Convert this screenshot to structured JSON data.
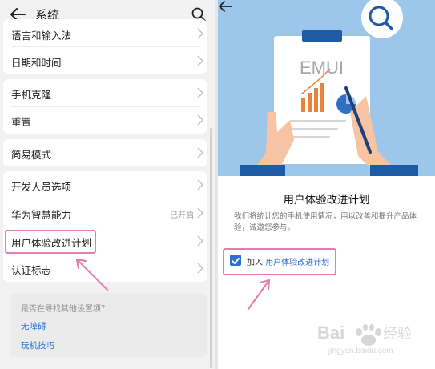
{
  "left": {
    "header_title": "系统",
    "groups": [
      {
        "items": [
          {
            "label": "语言和输入法"
          },
          {
            "label": "日期和时间"
          }
        ]
      },
      {
        "items": [
          {
            "label": "手机克隆"
          },
          {
            "label": "重置"
          }
        ]
      },
      {
        "items": [
          {
            "label": "简易模式"
          }
        ]
      },
      {
        "items": [
          {
            "label": "开发人员选项"
          },
          {
            "label": "华为智慧能力",
            "value": "已开启"
          },
          {
            "label": "用户体验改进计划"
          },
          {
            "label": "认证标志"
          }
        ]
      }
    ],
    "suggestion": {
      "question": "是否在寻找其他设置项？",
      "link1": "无障碍",
      "link2": "玩机技巧"
    }
  },
  "right": {
    "hero_text": "EMUI",
    "title": "用户体验改进计划",
    "description": "我们将统计您的手机使用情况，用以改善和提升产品体验，诚邀您参与。",
    "join_prefix": "加入 ",
    "join_link": "用户体验改进计划",
    "checkbox_checked": true
  },
  "watermark": {
    "text": "Baidu经验",
    "subtext": "jingyan.baidu.com"
  },
  "colors": {
    "accent": "#2b6fd6",
    "highlight": "#e080b0",
    "hero_bg": "#9cc7ea"
  }
}
